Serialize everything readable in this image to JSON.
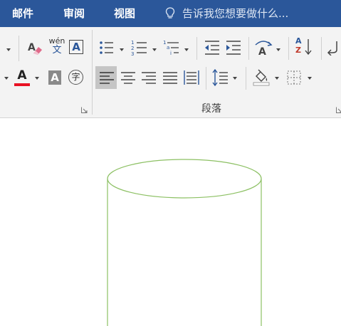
{
  "tabs": [
    {
      "label": "邮件"
    },
    {
      "label": "审阅"
    },
    {
      "label": "视图"
    }
  ],
  "tell_me": {
    "text": "告诉我您想要做什么..."
  },
  "ribbon": {
    "paragraph_group_label": "段落",
    "icons": {
      "clear_formatting": "eraser-icon",
      "phonetic_guide": "wén",
      "phonetic_guide_sub": "文",
      "character_border": "A",
      "font_color": "A",
      "character_shading": "A",
      "enclosed_character": "字",
      "sort_a": "A",
      "sort_z": "Z"
    },
    "colors": {
      "font_color_bar": "#e81123",
      "shading_fill": "#8a8a8a",
      "accent_blue": "#2b579a"
    }
  },
  "document": {
    "shape": "cylinder",
    "shape_outline_color": "#8cc063"
  }
}
